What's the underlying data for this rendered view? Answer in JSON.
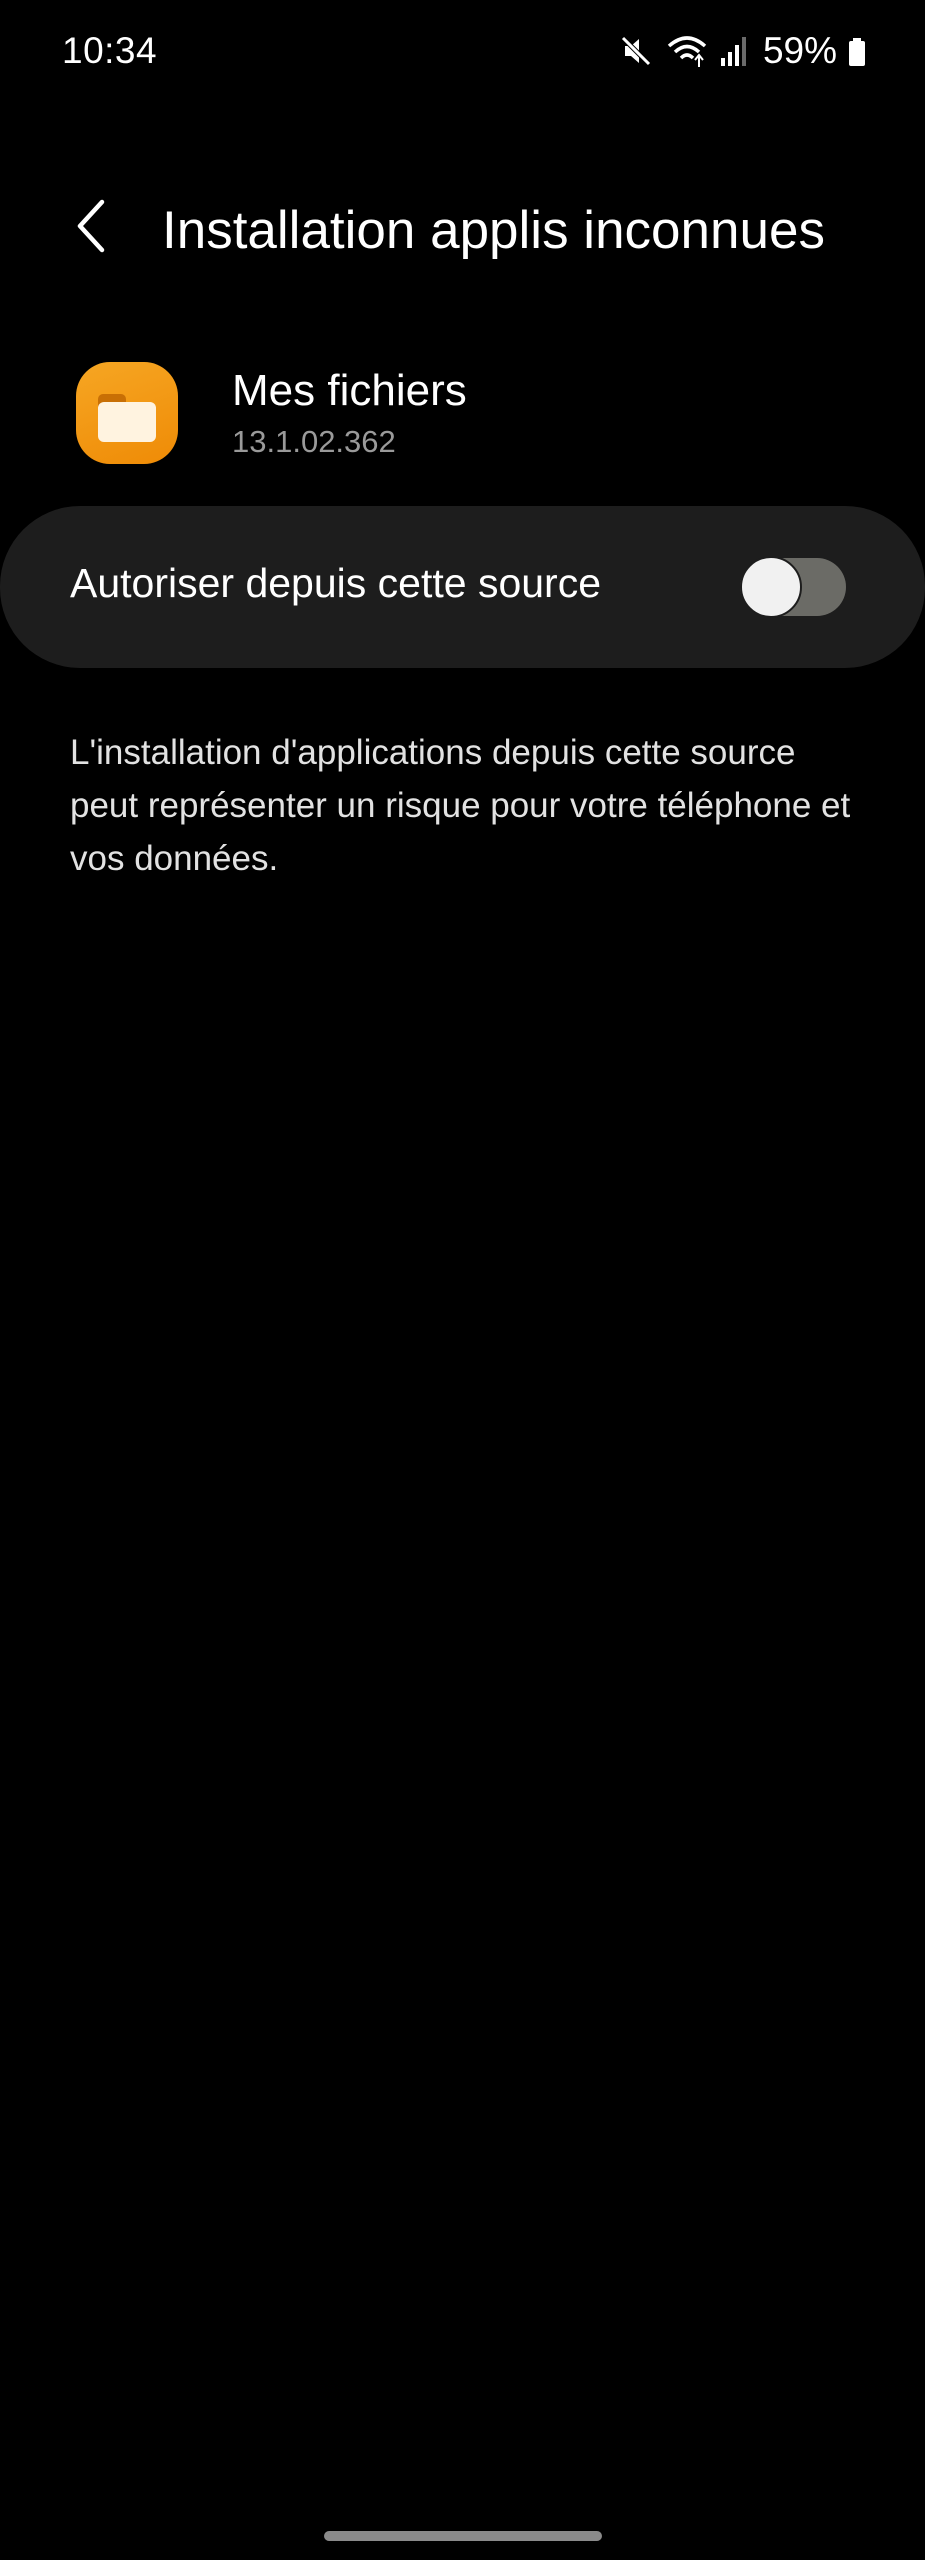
{
  "status_bar": {
    "time": "10:34",
    "battery_percent": "59%",
    "icons": [
      "mute-icon",
      "wifi-icon",
      "signal-icon",
      "battery-icon"
    ]
  },
  "header": {
    "title": "Installation applis inconnues",
    "back_icon": "chevron-left-icon"
  },
  "app": {
    "name": "Mes fichiers",
    "version": "13.1.02.362",
    "icon": "folder-icon",
    "icon_color": "#f39c12"
  },
  "setting": {
    "label": "Autoriser depuis cette source",
    "toggle_state": "off"
  },
  "description": "L'installation d'applications depuis cette source peut représenter un risque pour votre téléphone et vos données.",
  "colors": {
    "background": "#000000",
    "card": "#1d1d1d",
    "toggle_track_off": "#6b6b66",
    "secondary_text": "#9a9a9a"
  }
}
